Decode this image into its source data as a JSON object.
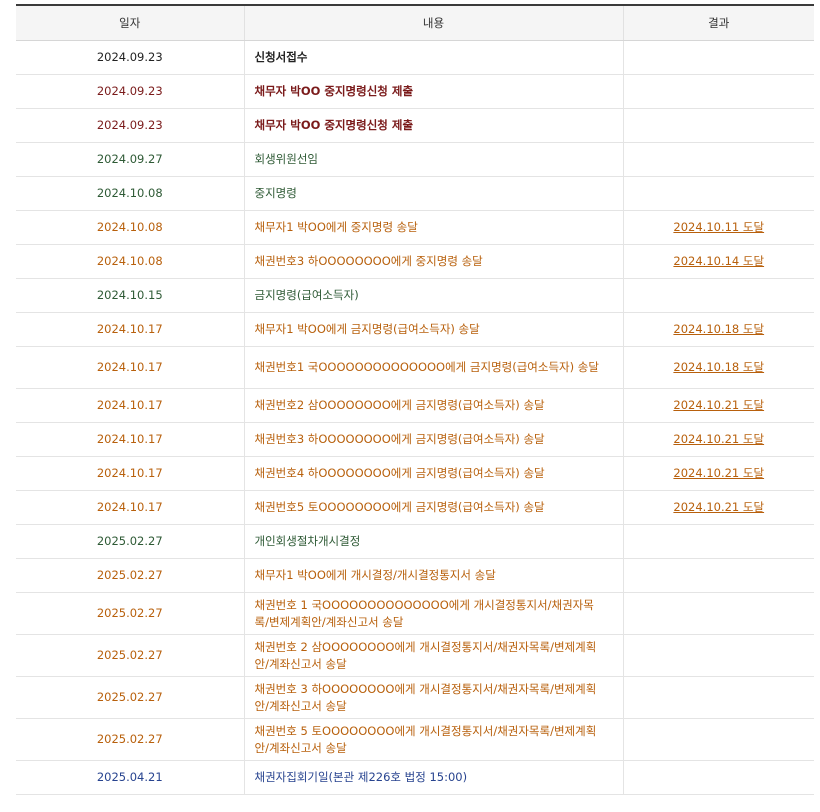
{
  "table": {
    "headers": {
      "date": "일자",
      "content": "내용",
      "result": "결과"
    },
    "rows": [
      {
        "date": "2024.09.23",
        "content": "신청서접수",
        "result": "",
        "tone": "black",
        "h": 1
      },
      {
        "date": "2024.09.23",
        "content": "채무자 박OO 중지명령신청 제출",
        "result": "",
        "tone": "maroon",
        "h": 1
      },
      {
        "date": "2024.09.23",
        "content": "채무자 박OO 중지명령신청 제출",
        "result": "",
        "tone": "maroon",
        "h": 1
      },
      {
        "date": "2024.09.27",
        "content": "회생위원선임",
        "result": "",
        "tone": "green",
        "h": 1
      },
      {
        "date": "2024.10.08",
        "content": "중지명령",
        "result": "",
        "tone": "green",
        "h": 1
      },
      {
        "date": "2024.10.08",
        "content": "채무자1 박OO에게 중지명령 송달",
        "result": "2024.10.11 도달",
        "tone": "orange",
        "h": 1
      },
      {
        "date": "2024.10.08",
        "content": "채권번호3 하OOOOOOOO에게 중지명령 송달",
        "result": "2024.10.14 도달",
        "tone": "orange",
        "h": 1
      },
      {
        "date": "2024.10.15",
        "content": "금지명령(급여소득자)",
        "result": "",
        "tone": "green",
        "h": 1
      },
      {
        "date": "2024.10.17",
        "content": "채무자1 박OO에게 금지명령(급여소득자) 송달",
        "result": "2024.10.18 도달",
        "tone": "orange",
        "h": 1
      },
      {
        "date": "2024.10.17",
        "content": "채권번호1 국OOOOOOOOOOOOOO에게 금지명령(급여소득자) 송달",
        "result": "2024.10.18 도달",
        "tone": "orange",
        "h": 2
      },
      {
        "date": "2024.10.17",
        "content": "채권번호2 삼OOOOOOOO에게 금지명령(급여소득자) 송달",
        "result": "2024.10.21 도달",
        "tone": "orange",
        "h": 1
      },
      {
        "date": "2024.10.17",
        "content": "채권번호3 하OOOOOOOO에게 금지명령(급여소득자) 송달",
        "result": "2024.10.21 도달",
        "tone": "orange",
        "h": 1
      },
      {
        "date": "2024.10.17",
        "content": "채권번호4 하OOOOOOOO에게 금지명령(급여소득자) 송달",
        "result": "2024.10.21 도달",
        "tone": "orange",
        "h": 1
      },
      {
        "date": "2024.10.17",
        "content": "채권번호5 토OOOOOOOO에게 금지명령(급여소득자) 송달",
        "result": "2024.10.21 도달",
        "tone": "orange",
        "h": 1
      },
      {
        "date": "2025.02.27",
        "content": "개인회생절차개시결정",
        "result": "",
        "tone": "green",
        "h": 1
      },
      {
        "date": "2025.02.27",
        "content": "채무자1 박OO에게 개시결정/개시결정통지서 송달",
        "result": "",
        "tone": "orange",
        "h": 1
      },
      {
        "date": "2025.02.27",
        "content": "채권번호 1 국OOOOOOOOOOOOOO에게 개시결정통지서/채권자목록/변제계획안/계좌신고서 송달",
        "result": "",
        "tone": "orange",
        "h": 2
      },
      {
        "date": "2025.02.27",
        "content": "채권번호 2 삼OOOOOOOO에게 개시결정통지서/채권자목록/변제계획안/계좌신고서 송달",
        "result": "",
        "tone": "orange",
        "h": 2
      },
      {
        "date": "2025.02.27",
        "content": "채권번호 3 하OOOOOOOO에게 개시결정통지서/채권자목록/변제계획안/계좌신고서 송달",
        "result": "",
        "tone": "orange",
        "h": 2
      },
      {
        "date": "2025.02.27",
        "content": "채권번호 5 토OOOOOOOO에게 개시결정통지서/채권자목록/변제계획안/계좌신고서 송달",
        "result": "",
        "tone": "orange",
        "h": 2
      },
      {
        "date": "2025.04.21",
        "content": "채권자집회기일(본관 제226호 법정 15:00)",
        "result": "",
        "tone": "blue",
        "h": 1
      }
    ]
  }
}
